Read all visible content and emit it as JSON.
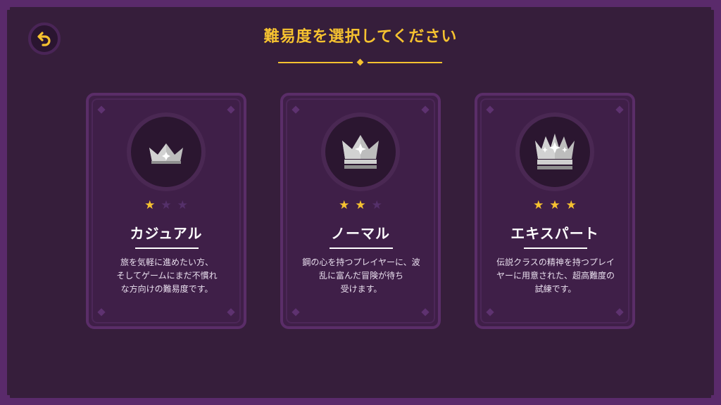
{
  "header": {
    "title": "難易度を選択してください",
    "back_icon": "back-arrow-icon"
  },
  "colors": {
    "accent": "#f6c230",
    "background": "#361e3b",
    "frame": "#5a2a6b",
    "card": "#3f1f48",
    "star_off": "#55306a"
  },
  "difficulties": [
    {
      "title": "カジュアル",
      "stars_total": 3,
      "stars_filled": 1,
      "icon": "crown-small-icon",
      "description_lines": [
        "旅を気軽に進めたい方、",
        "そしてゲームにまだ不慣れ",
        "な方向けの難易度です。"
      ]
    },
    {
      "title": "ノーマル",
      "stars_total": 3,
      "stars_filled": 2,
      "icon": "crown-medium-icon",
      "description_lines": [
        "鋼の心を持つプレイヤーに、波",
        "乱に富んだ冒険が待ち",
        "受けます。"
      ]
    },
    {
      "title": "エキスパート",
      "stars_total": 3,
      "stars_filled": 3,
      "icon": "crown-large-icon",
      "description_lines": [
        "伝説クラスの精神を持つプレイ",
        "ヤーに用意された、超高難度の",
        "試練です。"
      ]
    }
  ]
}
